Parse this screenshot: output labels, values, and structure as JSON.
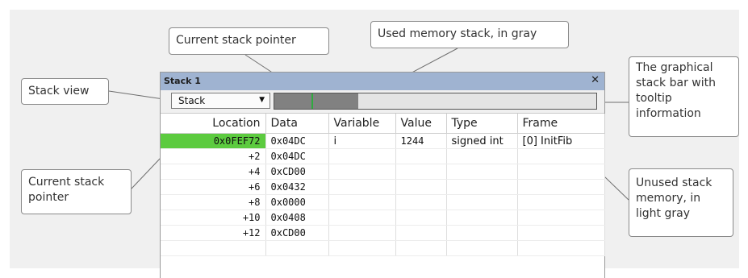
{
  "callouts": {
    "current_stack_pointer_top": "Current stack pointer",
    "used_memory": "Used memory stack, in gray",
    "stack_view": "Stack view",
    "graphical_bar": "The graphical\nstack bar with\ntooltip\ninformation",
    "current_stack_pointer_left": "Current stack\npointer",
    "unused_memory": "Unused stack\nmemory, in\nlight gray"
  },
  "window": {
    "title": "Stack 1",
    "close_glyph": "✕",
    "view_select": {
      "value": "Stack",
      "arrow": "▼"
    },
    "stack_bar": {
      "used_fraction": 0.26,
      "stack_pointer_fraction": 0.115,
      "used_color": "#818181",
      "unused_color": "#e4e4e4",
      "pointer_color": "#2faa3f"
    }
  },
  "columns": [
    "Location",
    "Data",
    "Variable",
    "Value",
    "Type",
    "Frame"
  ],
  "rows": [
    {
      "location": "0x0FEF72",
      "data": "0x04DC",
      "variable": "i",
      "value": "1244",
      "type": "signed int",
      "frame": "[0] InitFib",
      "current": true
    },
    {
      "location": "+2",
      "data": "0x04DC",
      "variable": "",
      "value": "",
      "type": "",
      "frame": ""
    },
    {
      "location": "+4",
      "data": "0xCD00",
      "variable": "",
      "value": "",
      "type": "",
      "frame": ""
    },
    {
      "location": "+6",
      "data": "0x0432",
      "variable": "",
      "value": "",
      "type": "",
      "frame": ""
    },
    {
      "location": "+8",
      "data": "0x0000",
      "variable": "",
      "value": "",
      "type": "",
      "frame": ""
    },
    {
      "location": "+10",
      "data": "0x0408",
      "variable": "",
      "value": "",
      "type": "",
      "frame": ""
    },
    {
      "location": "+12",
      "data": "0xCD00",
      "variable": "",
      "value": "",
      "type": "",
      "frame": ""
    },
    {
      "location": "",
      "data": "",
      "variable": "",
      "value": "",
      "type": "",
      "frame": ""
    }
  ],
  "colors": {
    "current_row_highlight": "#5ccb3f",
    "titlebar": "#9fb3d1"
  }
}
